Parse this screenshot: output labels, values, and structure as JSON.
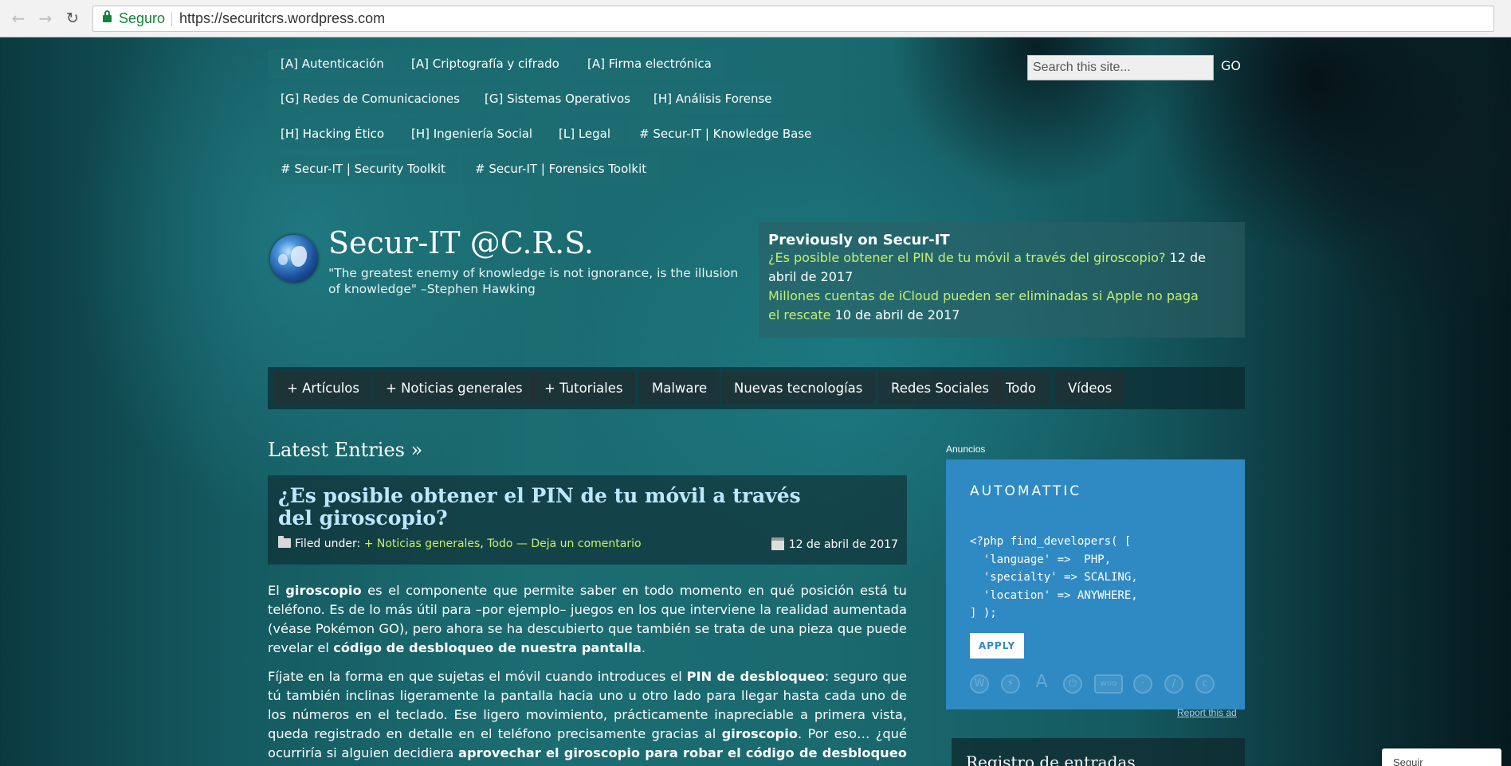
{
  "browser": {
    "back": "←",
    "forward": "→",
    "reload": "↻",
    "secure_label": "Seguro",
    "url": "https://securitcrs.wordpress.com"
  },
  "top_menu": [
    "[A] Autenticación",
    "[A] Criptografía y cifrado",
    "[A] Firma electrónica",
    "[G] Redes de Comunicaciones",
    "[G] Sistemas Operativos",
    "[H] Análisis Forense",
    "[H] Hacking Ético",
    "[H] Ingeniería Social",
    "[L] Legal",
    "# Secur-IT | Knowledge Base",
    "# Secur-IT | Security Toolkit",
    "# Secur-IT | Forensics Toolkit"
  ],
  "search": {
    "placeholder": "Search this site...",
    "button": "GO"
  },
  "site": {
    "title": "Secur-IT @C.R.S.",
    "description": "\"The greatest enemy of knowledge is not ignorance, is the illusion of knowledge\" –Stephen Hawking"
  },
  "previously": {
    "title": "Previously on Secur-IT",
    "entries": [
      {
        "link": "¿Es posible obtener el PIN de tu móvil a través del giroscopio?",
        "date": "12 de abril de 2017"
      },
      {
        "link": "Millones cuentas de iCloud pueden ser eliminadas si Apple no paga el rescate",
        "date": "10 de abril de 2017"
      }
    ]
  },
  "categories": [
    "+ Artículos",
    "+ Noticias generales",
    "+ Tutoriales",
    "Malware",
    "Nuevas tecnologías",
    "Redes Sociales",
    "Todo",
    "Vídeos"
  ],
  "latest_heading": "Latest Entries »",
  "post": {
    "title": "¿Es posible obtener el PIN de tu móvil a través del giroscopio?",
    "filed_under": "Filed under:",
    "cat1": "+ Noticias generales",
    "sep1": ",",
    "cat2": "Todo",
    "dash": "—",
    "comment": "Deja un comentario",
    "date": "12 de abril de 2017",
    "p1": {
      "a": "El ",
      "b": "giroscopio",
      "c": " es el componente que permite saber en todo momento en qué posición está tu teléfono. Es de lo más útil para –por ejemplo– juegos en los que interviene la realidad aumentada (véase Pokémon GO), pero ahora se ha descubierto que también se trata de una pieza que puede revelar el ",
      "d": "código de desbloqueo de nuestra pantalla",
      "e": "."
    },
    "p2": {
      "a": "Fíjate en la forma en que sujetas el móvil cuando introduces el ",
      "b": "PIN de desbloqueo",
      "c": ": seguro que tú también inclinas ligeramente la pantalla hacia uno u otro lado para llegar hasta cada uno de los números en el teclado. Ese ligero movimiento, prácticamente inapreciable a primera vista, queda registrado en detalle en el teléfono precisamente gracias al ",
      "d": "giroscopio",
      "e": ". Por eso… ¿qué ocurriría si alguien decidiera ",
      "f": "aprovechar el giroscopio para robar el código de desbloqueo de tu móvil",
      "g": "?"
    }
  },
  "ad": {
    "label": "Anuncios",
    "brand": "AUTOMATTIC",
    "code": "<?php find_developers( [\n  'language' =>  PHP,\n  'specialty' => SCALING,\n  'location' => ANYWHERE,\n] );",
    "apply": "APPLY",
    "icons": [
      "wordpress-icon",
      "jetpack-icon",
      "akismet-icon",
      "vaultpress-icon",
      "woo-icon",
      "polldaddy-icon",
      "longreads-icon",
      "crowdsignal-icon"
    ],
    "report": "Report this ad"
  },
  "widget": {
    "title": "Registro de entradas"
  },
  "follow": {
    "label": "Seguir"
  }
}
